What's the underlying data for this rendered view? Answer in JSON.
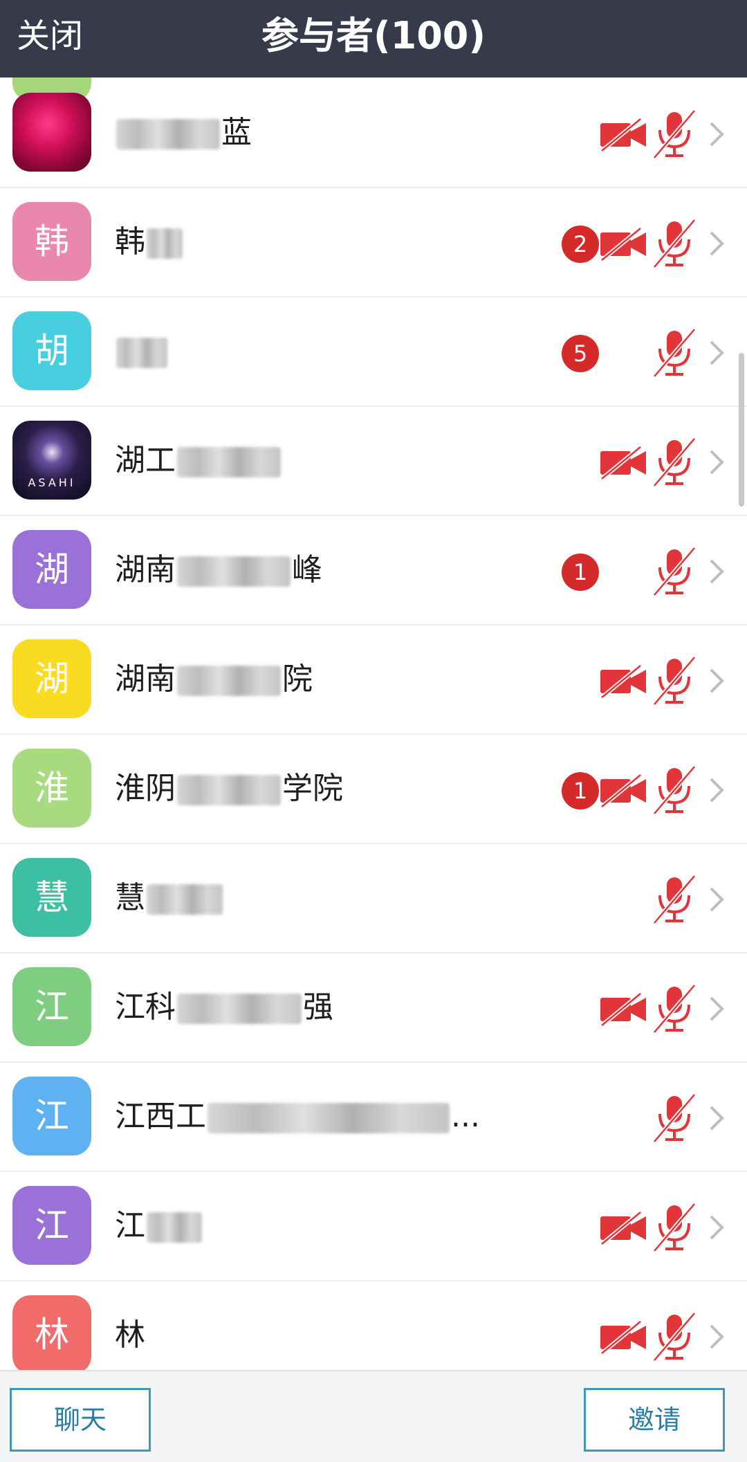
{
  "header": {
    "close_label": "关闭",
    "title": "参与者(100)"
  },
  "participants": [
    {
      "avatar_char": "",
      "avatar_type": "image-flower",
      "avatar_color": "#c2135a",
      "name_start": "",
      "name_end": "蓝",
      "badge": "",
      "camera_muted": true,
      "mic_muted": true
    },
    {
      "avatar_char": "韩",
      "avatar_type": "letter",
      "avatar_color": "#e987ad",
      "name_start": "韩",
      "name_end": "",
      "badge": "2",
      "camera_muted": true,
      "mic_muted": true
    },
    {
      "avatar_char": "胡",
      "avatar_type": "letter",
      "avatar_color": "#47cfe0",
      "name_start": "",
      "name_end": "",
      "badge": "5",
      "camera_muted": false,
      "mic_muted": true
    },
    {
      "avatar_char": "",
      "avatar_type": "image-asahi",
      "avatar_color": "#2a1f4a",
      "avatar_text": "ASAHI",
      "name_start": "湖工",
      "name_end": "",
      "badge": "",
      "camera_muted": true,
      "mic_muted": true
    },
    {
      "avatar_char": "湖",
      "avatar_type": "letter",
      "avatar_color": "#9a71d6",
      "name_start": "湖南",
      "name_end": "峰",
      "badge": "1",
      "camera_muted": false,
      "mic_muted": true
    },
    {
      "avatar_char": "湖",
      "avatar_type": "letter",
      "avatar_color": "#f9dc21",
      "name_start": "湖南",
      "name_end": "院",
      "badge": "",
      "camera_muted": true,
      "mic_muted": true
    },
    {
      "avatar_char": "淮",
      "avatar_type": "letter",
      "avatar_color": "#a8db7f",
      "name_start": "淮阴",
      "name_end": "学院",
      "badge": "1",
      "camera_muted": true,
      "mic_muted": true
    },
    {
      "avatar_char": "慧",
      "avatar_type": "letter",
      "avatar_color": "#3dbfa3",
      "name_start": "慧",
      "name_end": "",
      "badge": "",
      "camera_muted": false,
      "mic_muted": true
    },
    {
      "avatar_char": "江",
      "avatar_type": "letter",
      "avatar_color": "#7fcd81",
      "name_start": "江科",
      "name_end": "强",
      "badge": "",
      "camera_muted": true,
      "mic_muted": true
    },
    {
      "avatar_char": "江",
      "avatar_type": "letter",
      "avatar_color": "#5fb2f2",
      "name_start": "江西工",
      "name_end": "...",
      "badge": "",
      "camera_muted": false,
      "mic_muted": true
    },
    {
      "avatar_char": "江",
      "avatar_type": "letter",
      "avatar_color": "#9a71d6",
      "name_start": "江",
      "name_end": "",
      "badge": "",
      "camera_muted": true,
      "mic_muted": true
    },
    {
      "avatar_char": "林",
      "avatar_type": "letter",
      "avatar_color": "#f16b6b",
      "name_start": "林",
      "name_end": "",
      "badge": "",
      "camera_muted": true,
      "mic_muted": true
    }
  ],
  "footer": {
    "chat_label": "聊天",
    "invite_label": "邀请"
  },
  "colors": {
    "header_bg": "#363a4a",
    "muted_red": "#e2353a",
    "badge_red": "#d42a2a",
    "button_border": "#3f98b4"
  }
}
